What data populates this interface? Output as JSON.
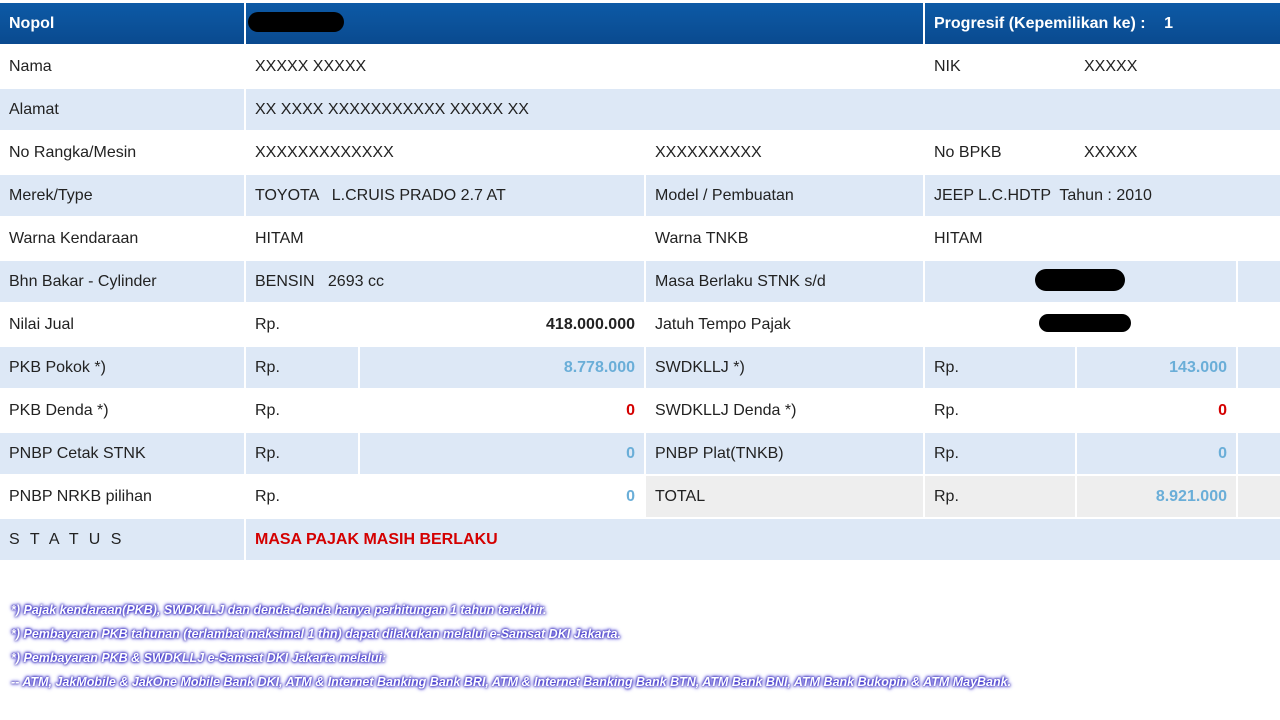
{
  "header": {
    "nopol_label": "Nopol",
    "progresif_label": "Progresif (Kepemilikan ke) :",
    "progresif_value": "1"
  },
  "rows": {
    "nama": {
      "label": "Nama",
      "value": "XXXXX XXXXX",
      "nik_label": "NIK",
      "nik_value": "XXXXX"
    },
    "alamat": {
      "label": "Alamat",
      "value": "XX XXXX XXXXXXXXXXX XXXXX XX"
    },
    "rangka": {
      "label": "No Rangka/Mesin",
      "rangka_value": "XXXXXXXXXXXXX",
      "mesin_value": "XXXXXXXXXX",
      "bpkb_label": "No BPKB",
      "bpkb_value": "XXXXX"
    },
    "merek": {
      "label": "Merek/Type",
      "value": "TOYOTA   L.CRUIS PRADO 2.7 AT",
      "model_label": "Model / Pembuatan",
      "model_value": "JEEP L.C.HDTP  Tahun : 2010"
    },
    "warna": {
      "label": "Warna Kendaraan",
      "value": "HITAM",
      "tnkb_label": "Warna TNKB",
      "tnkb_value": "HITAM"
    },
    "bahan": {
      "label": "Bhn Bakar - Cylinder",
      "value": "BENSIN   2693 cc",
      "stnk_label": "Masa Berlaku STNK s/d"
    },
    "nilai": {
      "label": "Nilai Jual",
      "rp": "Rp.",
      "value": "418.000.000",
      "tempo_label": "Jatuh Tempo Pajak"
    },
    "pkb_pokok": {
      "label": "PKB Pokok *)",
      "rp": "Rp.",
      "value": "8.778.000",
      "r_label": "SWDKLLJ *)",
      "r_rp": "Rp.",
      "r_value": "143.000"
    },
    "pkb_denda": {
      "label": "PKB Denda *)",
      "rp": "Rp.",
      "value": "0",
      "r_label": "SWDKLLJ Denda *)",
      "r_rp": "Rp.",
      "r_value": "0"
    },
    "pnbp_stnk": {
      "label": "PNBP Cetak STNK",
      "rp": "Rp.",
      "value": "0",
      "r_label": "PNBP Plat(TNKB)",
      "r_rp": "Rp.",
      "r_value": "0"
    },
    "pnbp_nrkb": {
      "label": "PNBP NRKB pilihan",
      "rp": "Rp.",
      "value": "0",
      "r_label": "TOTAL",
      "r_rp": "Rp.",
      "r_value": "8.921.000"
    },
    "status": {
      "label": "S T A T U S",
      "value": "MASA PAJAK MASIH BERLAKU"
    }
  },
  "notes": [
    "*) Pajak kendaraan(PKB), SWDKLLJ dan denda-denda hanya perhitungan 1 tahun terakhir.",
    "*) Pembayaran PKB tahunan (terlambat maksimal 1 thn) dapat dilakukan melalui e-Samsat DKI Jakarta.",
    "*) Pembayaran PKB & SWDKLLJ e-Samsat DKI Jakarta melalui:",
    "-- ATM, JakMobile & JakOne Mobile Bank DKI, ATM & Internet Banking Bank BRI, ATM & Internet Banking Bank BTN, ATM Bank BNI, ATM Bank Bukopin & ATM MayBank."
  ],
  "colors": {
    "header_blue": "#0a4f97",
    "row_blue": "#dde8f6",
    "amount_blue": "#6aaed8",
    "status_red": "#d40000"
  }
}
